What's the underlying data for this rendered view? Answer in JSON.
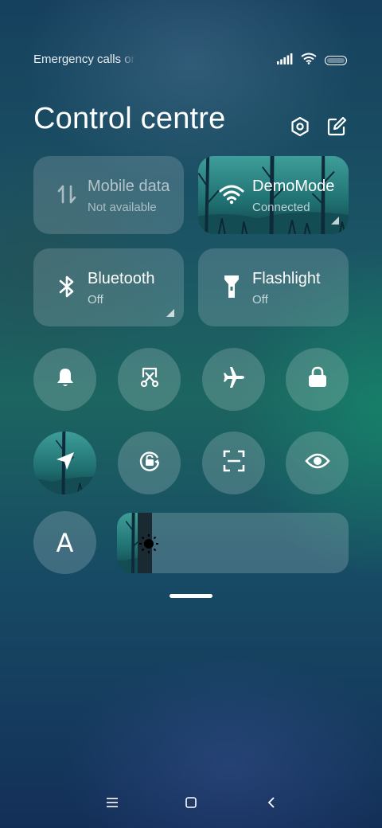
{
  "status_bar": {
    "carrier_text": "Emergency calls only",
    "icons": [
      "signal-icon",
      "wifi-icon",
      "battery-icon"
    ]
  },
  "header": {
    "title": "Control centre",
    "settings_icon": "gear-hexagon-icon",
    "edit_icon": "edit-icon"
  },
  "tiles": [
    {
      "label": "Mobile data",
      "status": "Not available",
      "icon": "mobile-data-icon",
      "active": false
    },
    {
      "label": "DemoMode",
      "status": "Connected",
      "icon": "wifi-icon",
      "active": true
    },
    {
      "label": "Bluetooth",
      "status": "Off",
      "icon": "bluetooth-icon",
      "active": false
    },
    {
      "label": "Flashlight",
      "status": "Off",
      "icon": "flashlight-icon",
      "active": false
    }
  ],
  "toggles": [
    {
      "icon": "bell-icon",
      "active": false
    },
    {
      "icon": "screenshot-scissors-icon",
      "active": false
    },
    {
      "icon": "airplane-icon",
      "active": false
    },
    {
      "icon": "lock-icon",
      "active": false
    },
    {
      "icon": "location-icon",
      "active": true
    },
    {
      "icon": "rotation-lock-icon",
      "active": false
    },
    {
      "icon": "scanner-icon",
      "active": false
    },
    {
      "icon": "eye-icon",
      "active": false
    }
  ],
  "auto_brightness": {
    "glyph": "A",
    "icon": "auto-brightness-icon"
  },
  "brightness": {
    "level": 0.15,
    "icon": "sun-icon"
  },
  "nav_bar": [
    "menu-icon",
    "home-icon",
    "back-icon"
  ],
  "colors": {
    "accent_active": "#1f7a78",
    "tile_bg": "rgba(255,255,255,0.16)"
  }
}
